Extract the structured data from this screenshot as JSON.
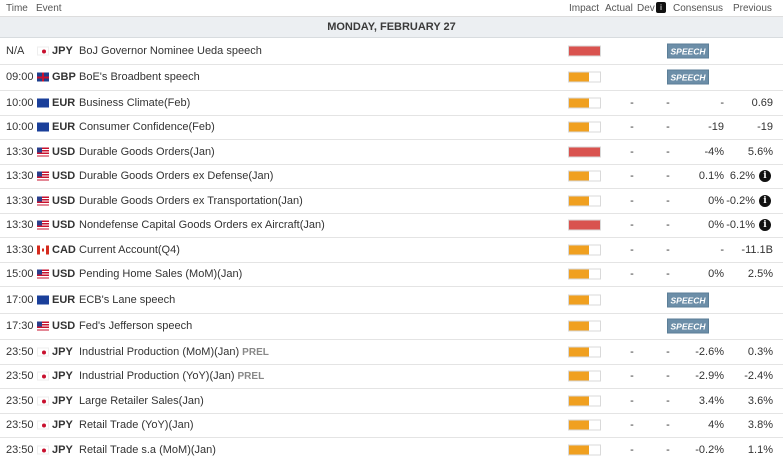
{
  "header": {
    "time": "Time",
    "event": "Event",
    "impact": "Impact",
    "actual": "Actual",
    "dev": "Dev",
    "consensus": "Consensus",
    "previous": "Previous"
  },
  "day_label": "MONDAY, FEBRUARY 27",
  "colors": {
    "high": "#d9534f",
    "medium": "#f0a020",
    "speech_badge": "#6c8ea8"
  },
  "rows": [
    {
      "time": "N/A",
      "ccy": "JPY",
      "flag": "jpy",
      "event": "BoJ Governor Nominee Ueda speech",
      "prel": "",
      "impact": "high",
      "impact_level": 1.0,
      "actual": "",
      "dev": "",
      "consensus": "",
      "previous": "",
      "speech": "SPEECH",
      "info": false
    },
    {
      "time": "09:00",
      "ccy": "GBP",
      "flag": "gbp",
      "event": "BoE's Broadbent speech",
      "prel": "",
      "impact": "medium",
      "impact_level": 0.66,
      "actual": "",
      "dev": "",
      "consensus": "",
      "previous": "",
      "speech": "SPEECH",
      "info": false
    },
    {
      "time": "10:00",
      "ccy": "EUR",
      "flag": "eur",
      "event": "Business Climate(Feb)",
      "prel": "",
      "impact": "medium",
      "impact_level": 0.66,
      "actual": "-",
      "dev": "-",
      "consensus": "-",
      "previous": "0.69",
      "speech": "",
      "info": false
    },
    {
      "time": "10:00",
      "ccy": "EUR",
      "flag": "eur",
      "event": "Consumer Confidence(Feb)",
      "prel": "",
      "impact": "medium",
      "impact_level": 0.66,
      "actual": "-",
      "dev": "-",
      "consensus": "-19",
      "previous": "-19",
      "speech": "",
      "info": false
    },
    {
      "time": "13:30",
      "ccy": "USD",
      "flag": "usd",
      "event": "Durable Goods Orders(Jan)",
      "prel": "",
      "impact": "high",
      "impact_level": 1.0,
      "actual": "-",
      "dev": "-",
      "consensus": "-4%",
      "previous": "5.6%",
      "speech": "",
      "info": false
    },
    {
      "time": "13:30",
      "ccy": "USD",
      "flag": "usd",
      "event": "Durable Goods Orders ex Defense(Jan)",
      "prel": "",
      "impact": "medium",
      "impact_level": 0.66,
      "actual": "-",
      "dev": "-",
      "consensus": "0.1%",
      "previous": "6.2%",
      "speech": "",
      "info": true
    },
    {
      "time": "13:30",
      "ccy": "USD",
      "flag": "usd",
      "event": "Durable Goods Orders ex Transportation(Jan)",
      "prel": "",
      "impact": "medium",
      "impact_level": 0.66,
      "actual": "-",
      "dev": "-",
      "consensus": "0%",
      "previous": "-0.2%",
      "speech": "",
      "info": true
    },
    {
      "time": "13:30",
      "ccy": "USD",
      "flag": "usd",
      "event": "Nondefense Capital Goods Orders ex Aircraft(Jan)",
      "prel": "",
      "impact": "high",
      "impact_level": 1.0,
      "actual": "-",
      "dev": "-",
      "consensus": "0%",
      "previous": "-0.1%",
      "speech": "",
      "info": true
    },
    {
      "time": "13:30",
      "ccy": "CAD",
      "flag": "cad",
      "event": "Current Account(Q4)",
      "prel": "",
      "impact": "medium",
      "impact_level": 0.66,
      "actual": "-",
      "dev": "-",
      "consensus": "-",
      "previous": "-11.1B",
      "speech": "",
      "info": false
    },
    {
      "time": "15:00",
      "ccy": "USD",
      "flag": "usd",
      "event": "Pending Home Sales (MoM)(Jan)",
      "prel": "",
      "impact": "medium",
      "impact_level": 0.66,
      "actual": "-",
      "dev": "-",
      "consensus": "0%",
      "previous": "2.5%",
      "speech": "",
      "info": false
    },
    {
      "time": "17:00",
      "ccy": "EUR",
      "flag": "eur",
      "event": "ECB's Lane speech",
      "prel": "",
      "impact": "medium",
      "impact_level": 0.66,
      "actual": "",
      "dev": "",
      "consensus": "",
      "previous": "",
      "speech": "SPEECH",
      "info": false
    },
    {
      "time": "17:30",
      "ccy": "USD",
      "flag": "usd",
      "event": "Fed's Jefferson speech",
      "prel": "",
      "impact": "medium",
      "impact_level": 0.66,
      "actual": "",
      "dev": "",
      "consensus": "",
      "previous": "",
      "speech": "SPEECH",
      "info": false
    },
    {
      "time": "23:50",
      "ccy": "JPY",
      "flag": "jpy",
      "event": "Industrial Production (MoM)(Jan)",
      "prel": "PREL",
      "impact": "medium",
      "impact_level": 0.66,
      "actual": "-",
      "dev": "-",
      "consensus": "-2.6%",
      "previous": "0.3%",
      "speech": "",
      "info": false
    },
    {
      "time": "23:50",
      "ccy": "JPY",
      "flag": "jpy",
      "event": "Industrial Production (YoY)(Jan)",
      "prel": "PREL",
      "impact": "medium",
      "impact_level": 0.66,
      "actual": "-",
      "dev": "-",
      "consensus": "-2.9%",
      "previous": "-2.4%",
      "speech": "",
      "info": false
    },
    {
      "time": "23:50",
      "ccy": "JPY",
      "flag": "jpy",
      "event": "Large Retailer Sales(Jan)",
      "prel": "",
      "impact": "medium",
      "impact_level": 0.66,
      "actual": "-",
      "dev": "-",
      "consensus": "3.4%",
      "previous": "3.6%",
      "speech": "",
      "info": false
    },
    {
      "time": "23:50",
      "ccy": "JPY",
      "flag": "jpy",
      "event": "Retail Trade (YoY)(Jan)",
      "prel": "",
      "impact": "medium",
      "impact_level": 0.66,
      "actual": "-",
      "dev": "-",
      "consensus": "4%",
      "previous": "3.8%",
      "speech": "",
      "info": false
    },
    {
      "time": "23:50",
      "ccy": "JPY",
      "flag": "jpy",
      "event": "Retail Trade s.a (MoM)(Jan)",
      "prel": "",
      "impact": "medium",
      "impact_level": 0.66,
      "actual": "-",
      "dev": "-",
      "consensus": "-0.2%",
      "previous": "1.1%",
      "speech": "",
      "info": false
    }
  ]
}
